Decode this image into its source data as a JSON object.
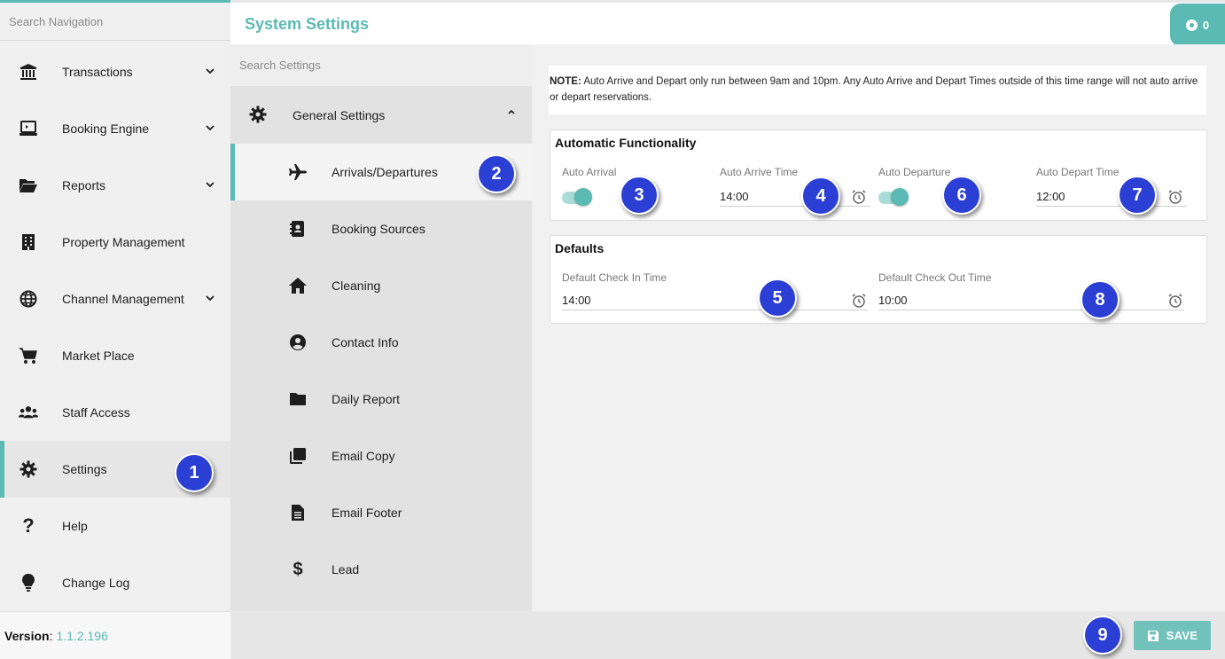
{
  "nav": {
    "search_placeholder": "Search Navigation",
    "items": [
      {
        "label": "Transactions",
        "icon": "bank-icon",
        "has_chevron": true
      },
      {
        "label": "Booking Engine",
        "icon": "laptop-icon",
        "has_chevron": true
      },
      {
        "label": "Reports",
        "icon": "folder-open-icon",
        "has_chevron": true
      },
      {
        "label": "Property Management",
        "icon": "building-icon",
        "has_chevron": false
      },
      {
        "label": "Channel Management",
        "icon": "globe-icon",
        "has_chevron": true
      },
      {
        "label": "Market Place",
        "icon": "cart-icon",
        "has_chevron": false
      },
      {
        "label": "Staff Access",
        "icon": "users-icon",
        "has_chevron": false
      },
      {
        "label": "Settings",
        "icon": "gear-icon",
        "has_chevron": false,
        "active": true
      },
      {
        "label": "Help",
        "icon": "question-icon",
        "has_chevron": false
      },
      {
        "label": "Change Log",
        "icon": "lightbulb-icon",
        "has_chevron": false
      }
    ],
    "version_label": "Version",
    "version_sep": ":",
    "version_value": "1.1.2.196"
  },
  "header": {
    "title": "System Settings",
    "notification_count": "0"
  },
  "subnav": {
    "search_placeholder": "Search Settings",
    "group_label": "General Settings",
    "items": [
      {
        "label": "Arrivals/Departures",
        "icon": "airplane-icon",
        "active": true
      },
      {
        "label": "Booking Sources",
        "icon": "contact-book-icon"
      },
      {
        "label": "Cleaning",
        "icon": "home-icon"
      },
      {
        "label": "Contact Info",
        "icon": "account-circle-icon"
      },
      {
        "label": "Daily Report",
        "icon": "folder-icon"
      },
      {
        "label": "Email Copy",
        "icon": "copy-icon"
      },
      {
        "label": "Email Footer",
        "icon": "document-icon"
      },
      {
        "label": "Lead",
        "icon": "dollar-icon"
      }
    ]
  },
  "main": {
    "note_label": "NOTE:",
    "note_text": " Auto Arrive and Depart only run between 9am and 10pm. Any Auto Arrive and Depart Times outside of this time range will not auto arrive or depart reservations.",
    "auto": {
      "title": "Automatic Functionality",
      "auto_arrival_label": "Auto Arrival",
      "auto_arrival_on": true,
      "auto_arrive_time_label": "Auto Arrive Time",
      "auto_arrive_time_value": "14:00",
      "auto_departure_label": "Auto Departure",
      "auto_departure_on": true,
      "auto_depart_time_label": "Auto Depart Time",
      "auto_depart_time_value": "12:00"
    },
    "defaults": {
      "title": "Defaults",
      "check_in_label": "Default Check In Time",
      "check_in_value": "14:00",
      "check_out_label": "Default Check Out Time",
      "check_out_value": "10:00"
    }
  },
  "footer": {
    "save_label": "SAVE"
  },
  "markers": [
    "1",
    "2",
    "3",
    "4",
    "5",
    "6",
    "7",
    "8",
    "9"
  ],
  "colors": {
    "accent": "#5bbab3",
    "marker": "#2b3fd4"
  }
}
